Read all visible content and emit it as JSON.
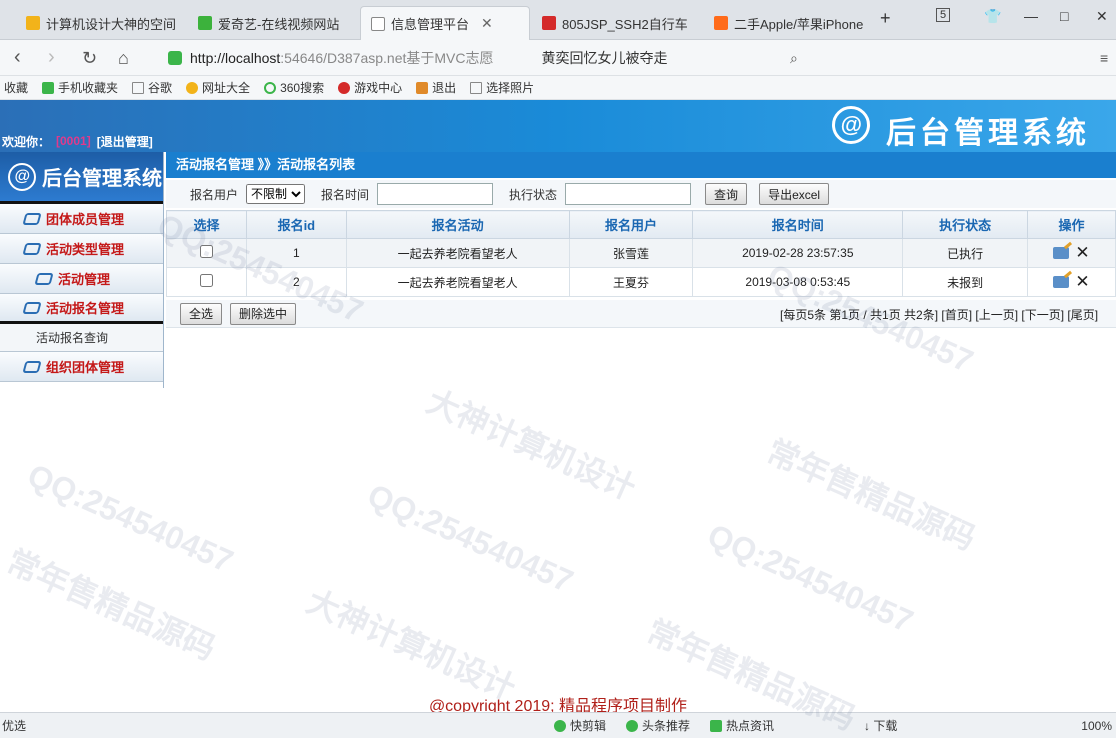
{
  "browser": {
    "tabs": [
      {
        "label": "计算机设计大神的空间",
        "color": "#f2b31a"
      },
      {
        "label": "爱奇艺-在线视频网站",
        "color": "#3cb23c"
      },
      {
        "label": "信息管理平台",
        "color": "#ffffff",
        "active": true
      },
      {
        "label": "805JSP_SSH2自行车",
        "color": "#d42a2a"
      },
      {
        "label": "二手Apple/苹果iPhone",
        "color": "#ff6b1a"
      }
    ],
    "tab_count": "5",
    "url_host": "http://localhost",
    "url_path": ":54646/D387asp.net基于MVC志愿",
    "news_text": "黄奕回忆女儿被夺走",
    "bookmarks": [
      "收藏",
      "手机收藏夹",
      "谷歌",
      "网址大全",
      "360搜索",
      "游戏中心",
      "退出",
      "选择照片"
    ]
  },
  "header": {
    "title": "后台管理系统",
    "welcome_prefix": "欢迎你：",
    "user": "[0001]",
    "logout": "[退出管理]"
  },
  "sidebar": {
    "title": "后台管理系统",
    "items": [
      {
        "label": "团体成员管理"
      },
      {
        "label": "活动类型管理"
      },
      {
        "label": "活动管理"
      },
      {
        "label": "活动报名管理"
      },
      {
        "label": "活动报名查询"
      },
      {
        "label": "组织团体管理"
      }
    ]
  },
  "breadcrumb": "活动报名管理 》》活动报名列表",
  "filter": {
    "user_label": "报名用户",
    "user_option": "不限制",
    "time_label": "报名时间",
    "time_value": "",
    "state_label": "执行状态",
    "state_value": "",
    "query_button": "查询",
    "export_button": "导出excel"
  },
  "table": {
    "headers": [
      "选择",
      "报名id",
      "报名活动",
      "报名用户",
      "报名时间",
      "执行状态",
      "操作"
    ],
    "rows": [
      {
        "id": "1",
        "activity": "一起去养老院看望老人",
        "user": "张雪莲",
        "time": "2019-02-28 23:57:35",
        "state": "已执行"
      },
      {
        "id": "2",
        "activity": "一起去养老院看望老人",
        "user": "王夏芬",
        "time": "2019-03-08 0:53:45",
        "state": "未报到"
      }
    ]
  },
  "pager": {
    "select_all": "全选",
    "delete_selected": "删除选中",
    "info": "[每页5条 第1页 / 共1页 共2条]  [首页]  [上一页]  [下一页]  [尾页]"
  },
  "footer": "@copyright 2019; 精品程序项目制作",
  "statusbar": {
    "left": "优选",
    "items": [
      "快剪辑",
      "头条推荐",
      "热点资讯"
    ],
    "download": "下载",
    "zoom": "100%"
  },
  "watermark": [
    "常年售精品源码",
    "QQ:254540457",
    "大神计算机设计"
  ]
}
